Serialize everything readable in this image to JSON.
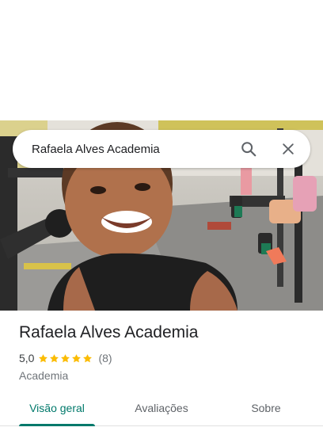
{
  "search": {
    "query": "Rafaela Alves Academia",
    "search_icon": "search-icon",
    "close_icon": "close-icon"
  },
  "photo": {
    "description_icon": "place-photo"
  },
  "place": {
    "name": "Rafaela Alves Academia",
    "rating": "5,0",
    "stars": 5,
    "review_count": "(8)",
    "category": "Academia"
  },
  "tabs": [
    {
      "label": "Visão geral",
      "active": true
    },
    {
      "label": "Avaliações",
      "active": false
    },
    {
      "label": "Sobre",
      "active": false
    }
  ],
  "colors": {
    "accent": "#00796b",
    "star": "#fbbc04",
    "text_primary": "#202124",
    "text_secondary": "#70757a"
  }
}
